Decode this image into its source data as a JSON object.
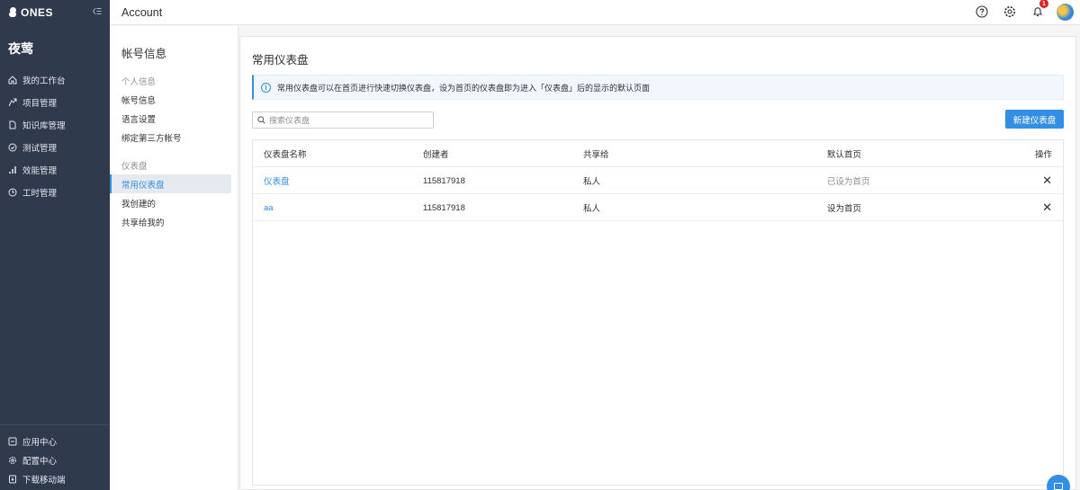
{
  "app": {
    "logo_text": "ONES",
    "team_name": "夜莺"
  },
  "nav": {
    "items": [
      {
        "label": "我的工作台",
        "icon": "home-icon"
      },
      {
        "label": "项目管理",
        "icon": "project-icon"
      },
      {
        "label": "知识库管理",
        "icon": "wiki-icon"
      },
      {
        "label": "测试管理",
        "icon": "test-icon"
      },
      {
        "label": "效能管理",
        "icon": "chart-icon"
      },
      {
        "label": "工时管理",
        "icon": "clock-icon"
      }
    ],
    "bottom_items": [
      {
        "label": "应用中心",
        "icon": "app-center-icon"
      },
      {
        "label": "配置中心",
        "icon": "gear-icon"
      },
      {
        "label": "下载移动端",
        "icon": "mobile-icon"
      }
    ]
  },
  "header": {
    "title": "Account",
    "notification_count": "1"
  },
  "subnav": {
    "heading": "帐号信息",
    "groups": [
      {
        "label": "个人信息",
        "items": [
          "帐号信息",
          "语言设置",
          "绑定第三方帐号"
        ]
      },
      {
        "label": "仪表盘",
        "items": [
          "常用仪表盘",
          "我创建的",
          "共享给我的"
        ]
      }
    ],
    "active_item": "常用仪表盘"
  },
  "main": {
    "title": "常用仪表盘",
    "notice": "常用仪表盘可以在首页进行快速切换仪表盘，设为首页的仪表盘即为进入「仪表盘」后的显示的默认页面",
    "search_placeholder": "搜索仪表盘",
    "new_button": "新建仪表盘",
    "table": {
      "columns": [
        "仪表盘名称",
        "创建者",
        "共享给",
        "默认首页",
        "操作"
      ],
      "rows": [
        {
          "name": "仪表盘",
          "creator": "115817918",
          "shared": "私人",
          "default_home": "已设为首页",
          "action": "✕"
        },
        {
          "name": "aa",
          "creator": "115817918",
          "shared": "私人",
          "default_home": "设为首页",
          "action": "✕"
        }
      ]
    }
  },
  "colors": {
    "accent": "#338fe5",
    "sidebar_bg": "#2f3a4d",
    "badge": "#e02020"
  }
}
